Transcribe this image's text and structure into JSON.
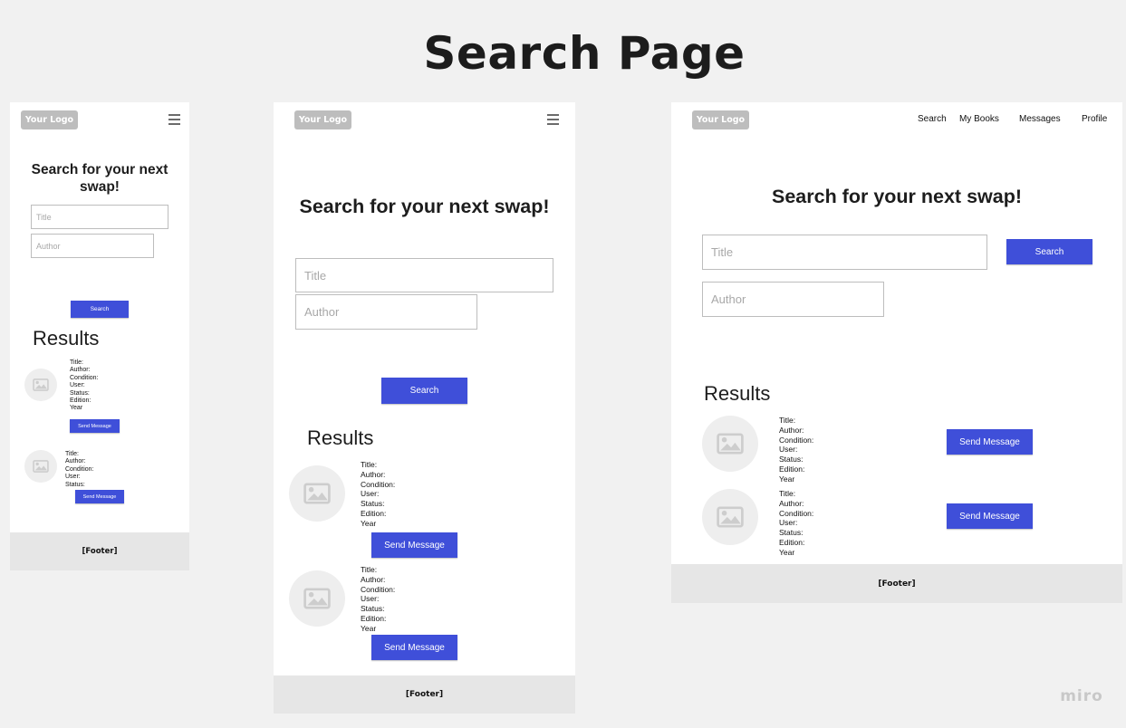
{
  "page_title": "Search Page",
  "logo": "Your Logo",
  "heading": "Search for your next swap!",
  "title_placeholder": "Title",
  "author_placeholder": "Author",
  "search_button": "Search",
  "results_heading": "Results",
  "send_button": "Send Message",
  "footer": "[Footer]",
  "nav": [
    "Search",
    "My Books",
    "Messages",
    "Profile"
  ],
  "result_fields": [
    "Title:",
    "Author:",
    "Condition:",
    "User:",
    "Status:",
    "Edition:",
    "Year"
  ],
  "result_fields_short": [
    "Title:",
    "Author:",
    "Condition:",
    "User:",
    "Status:"
  ],
  "watermark": "miro",
  "colors": {
    "accent": "#3f4fd9",
    "footer_bg": "#e6e6e6",
    "canvas_bg": "#f1f1f1"
  }
}
